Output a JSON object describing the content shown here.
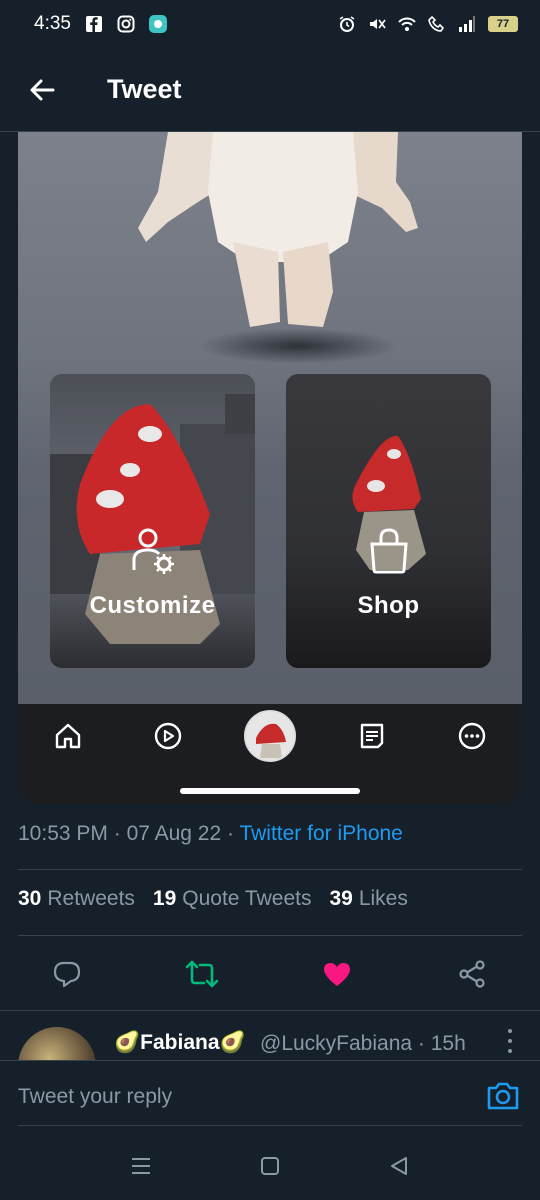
{
  "status_bar": {
    "time": "4:35",
    "battery": "77",
    "icons": [
      "facebook-icon",
      "instagram-icon",
      "app-icon",
      "alarm-icon",
      "mute-icon",
      "wifi-icon",
      "wifi-call-icon",
      "signal-icon",
      "battery-icon"
    ]
  },
  "header": {
    "title": "Tweet",
    "back_icon": "arrow-left-icon"
  },
  "media": {
    "cards": [
      {
        "label": "Customize",
        "icon": "avatar-gear-icon"
      },
      {
        "label": "Shop",
        "icon": "shopping-bag-icon"
      }
    ],
    "app_nav": [
      "home-icon",
      "play-icon",
      "avatar",
      "chat-icon",
      "more-icon"
    ]
  },
  "tweet_meta": {
    "time": "10:53 PM",
    "sep1": " · ",
    "date": "07 Aug 22",
    "sep2": " · ",
    "source": "Twitter for iPhone"
  },
  "stats": {
    "retweets_count": "30",
    "retweets_label": "Retweets",
    "quotes_count": "19",
    "quotes_label": "Quote Tweets",
    "likes_count": "39",
    "likes_label": "Likes"
  },
  "actions": {
    "reply": "reply-icon",
    "retweet": "retweet-icon",
    "like": "heart-icon",
    "share": "share-icon",
    "retweet_color": "#00ba7c",
    "like_color": "#f91880"
  },
  "reply_preview": {
    "name": "🥑Fabiana🥑",
    "handle": "@LuckyFabiana · 15h"
  },
  "composer": {
    "placeholder": "Tweet your reply",
    "camera_icon": "camera-icon"
  },
  "colors": {
    "background": "#15202b",
    "accent": "#1d9bf0",
    "secondary_text": "#8b98a5",
    "divider": "#38444d"
  }
}
